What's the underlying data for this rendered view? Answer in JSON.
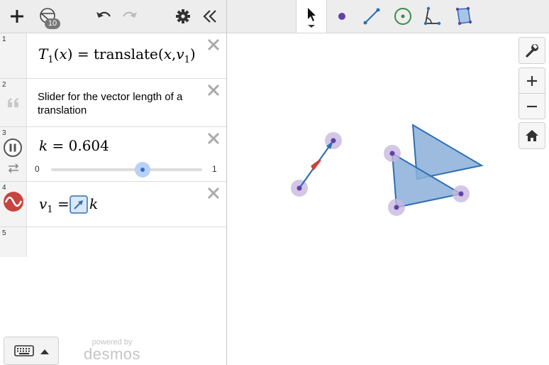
{
  "toolbar": {
    "add_icon": "plus-icon",
    "shapes_icon": "shapes-icon",
    "shapes_count": "10",
    "undo_icon": "undo-icon",
    "redo_icon": "redo-icon",
    "settings_icon": "gear-icon",
    "collapse_icon": "double-chevron-left-icon"
  },
  "expressions": [
    {
      "number": "1",
      "type": "math",
      "latex": "T_1(x)=translate(x,v_1)",
      "parts": {
        "fn": "T",
        "fn_sub": "1",
        "arg": "x",
        "eq": "=",
        "op": "translate",
        "arg1": "x",
        "comma": ",",
        "arg2": "v",
        "arg2_sub": "1"
      }
    },
    {
      "number": "2",
      "type": "note",
      "text": "Slider for the vector length of a translation"
    },
    {
      "number": "3",
      "type": "slider",
      "var": "k",
      "value": "0.604",
      "min": "0",
      "max": "1",
      "fraction": 0.604
    },
    {
      "number": "4",
      "type": "vector",
      "lhs": "v",
      "lhs_sub": "1",
      "rhs": "k"
    },
    {
      "number": "5",
      "type": "empty"
    }
  ],
  "bottom": {
    "keyboard_icon": "keyboard-icon",
    "powered_by": "powered by",
    "brand": "desmos"
  },
  "tools": [
    "select-tool",
    "point-tool",
    "segment-tool",
    "circle-tool",
    "angle-tool",
    "polygon-tool"
  ],
  "colors": {
    "accent_blue": "#2d70b3",
    "polygon_fill": "#8bafd9",
    "point_purple": "#6042a6",
    "point_halo": "#c8b8e0",
    "vector_red": "#c74440",
    "circle_green": "#388c46"
  }
}
